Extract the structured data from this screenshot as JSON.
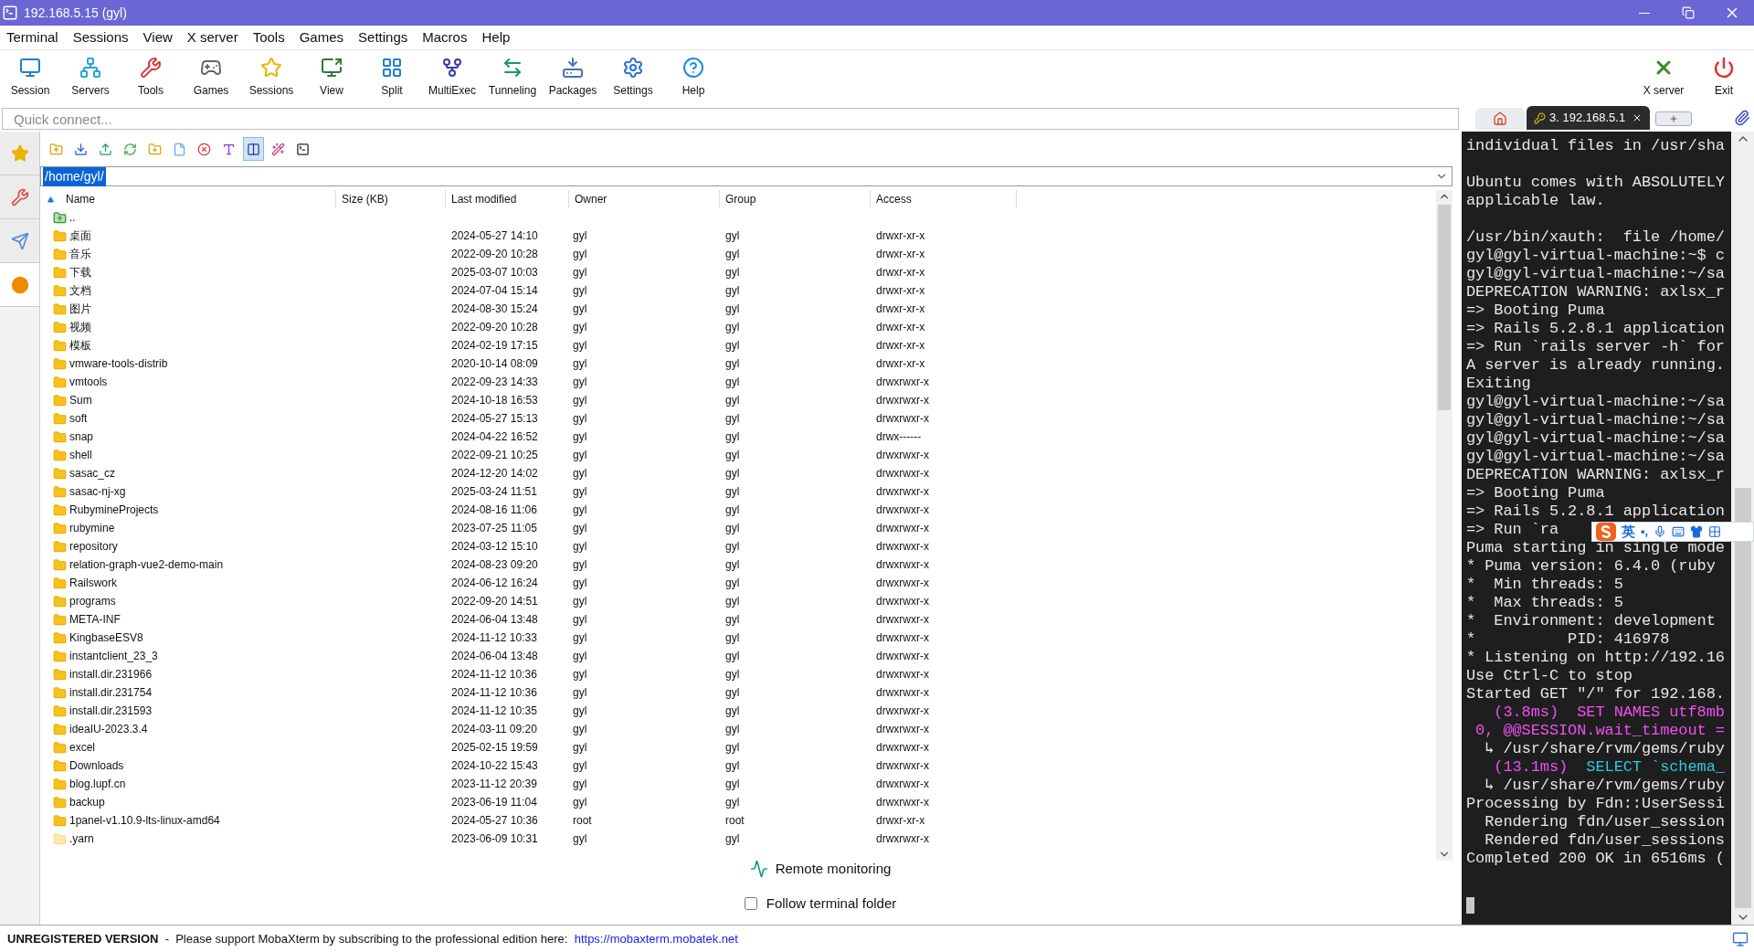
{
  "window": {
    "title": "192.168.5.15 (gyl)"
  },
  "menu": [
    "Terminal",
    "Sessions",
    "View",
    "X server",
    "Tools",
    "Games",
    "Settings",
    "Macros",
    "Help"
  ],
  "toolbar": [
    "Session",
    "Servers",
    "Tools",
    "Games",
    "Sessions",
    "View",
    "Split",
    "MultiExec",
    "Tunneling",
    "Packages",
    "Settings",
    "Help"
  ],
  "toolbar_right": [
    "X server",
    "Exit"
  ],
  "quick_connect": {
    "placeholder": "Quick connect..."
  },
  "session_tabs": [
    {
      "kind": "home",
      "selected": false
    },
    {
      "kind": "terminal",
      "label": "3. 192.168.5.1",
      "selected": true
    },
    {
      "kind": "new",
      "selected": false
    }
  ],
  "sidebar_tabs": [
    {
      "selected": false
    },
    {
      "selected": false
    },
    {
      "selected": false
    },
    {
      "selected": true
    }
  ],
  "file_tools": [
    {
      "pressed": false
    },
    {
      "pressed": false
    },
    {
      "pressed": false
    },
    {
      "pressed": false
    },
    {
      "pressed": false
    },
    {
      "pressed": false
    },
    {
      "pressed": false
    },
    {
      "pressed": false
    },
    {
      "pressed": true
    },
    {
      "pressed": false
    },
    {
      "pressed": false
    }
  ],
  "path": "/home/gyl/",
  "columns": [
    {
      "label": "Name",
      "sorted": true
    },
    {
      "label": "Size (KB)",
      "sorted": false
    },
    {
      "label": "Last modified",
      "sorted": false
    },
    {
      "label": "Owner",
      "sorted": false
    },
    {
      "label": "Group",
      "sorted": false
    },
    {
      "label": "Access",
      "sorted": false
    }
  ],
  "rows": [
    {
      "kind": "parent",
      "name": ".."
    },
    {
      "kind": "folder",
      "name": "桌面",
      "modified": "2024-05-27 14:10",
      "owner": "gyl",
      "group": "gyl",
      "access": "drwxr-xr-x"
    },
    {
      "kind": "folder",
      "name": "音乐",
      "modified": "2022-09-20 10:28",
      "owner": "gyl",
      "group": "gyl",
      "access": "drwxr-xr-x"
    },
    {
      "kind": "folder",
      "name": "下载",
      "modified": "2025-03-07 10:03",
      "owner": "gyl",
      "group": "gyl",
      "access": "drwxr-xr-x"
    },
    {
      "kind": "folder",
      "name": "文档",
      "modified": "2024-07-04 15:14",
      "owner": "gyl",
      "group": "gyl",
      "access": "drwxr-xr-x"
    },
    {
      "kind": "folder",
      "name": "图片",
      "modified": "2024-08-30 15:24",
      "owner": "gyl",
      "group": "gyl",
      "access": "drwxr-xr-x"
    },
    {
      "kind": "folder",
      "name": "视频",
      "modified": "2022-09-20 10:28",
      "owner": "gyl",
      "group": "gyl",
      "access": "drwxr-xr-x"
    },
    {
      "kind": "folder",
      "name": "模板",
      "modified": "2024-02-19 17:15",
      "owner": "gyl",
      "group": "gyl",
      "access": "drwxr-xr-x"
    },
    {
      "kind": "folder",
      "name": "vmware-tools-distrib",
      "modified": "2020-10-14 08:09",
      "owner": "gyl",
      "group": "gyl",
      "access": "drwxr-xr-x"
    },
    {
      "kind": "folder",
      "name": "vmtools",
      "modified": "2022-09-23 14:33",
      "owner": "gyl",
      "group": "gyl",
      "access": "drwxrwxr-x"
    },
    {
      "kind": "folder",
      "name": "Sum",
      "modified": "2024-10-18 16:53",
      "owner": "gyl",
      "group": "gyl",
      "access": "drwxrwxr-x"
    },
    {
      "kind": "folder",
      "name": "soft",
      "modified": "2024-05-27 15:13",
      "owner": "gyl",
      "group": "gyl",
      "access": "drwxrwxr-x"
    },
    {
      "kind": "folder",
      "name": "snap",
      "modified": "2024-04-22 16:52",
      "owner": "gyl",
      "group": "gyl",
      "access": "drwx------"
    },
    {
      "kind": "folder",
      "name": "shell",
      "modified": "2022-09-21 10:25",
      "owner": "gyl",
      "group": "gyl",
      "access": "drwxrwxr-x"
    },
    {
      "kind": "folder",
      "name": "sasac_cz",
      "modified": "2024-12-20 14:02",
      "owner": "gyl",
      "group": "gyl",
      "access": "drwxrwxr-x"
    },
    {
      "kind": "folder",
      "name": "sasac-nj-xg",
      "modified": "2025-03-24 11:51",
      "owner": "gyl",
      "group": "gyl",
      "access": "drwxrwxr-x"
    },
    {
      "kind": "folder",
      "name": "RubymineProjects",
      "modified": "2024-08-16 11:06",
      "owner": "gyl",
      "group": "gyl",
      "access": "drwxrwxr-x"
    },
    {
      "kind": "folder",
      "name": "rubymine",
      "modified": "2023-07-25 11:05",
      "owner": "gyl",
      "group": "gyl",
      "access": "drwxrwxr-x"
    },
    {
      "kind": "folder",
      "name": "repository",
      "modified": "2024-03-12 15:10",
      "owner": "gyl",
      "group": "gyl",
      "access": "drwxrwxr-x"
    },
    {
      "kind": "folder",
      "name": "relation-graph-vue2-demo-main",
      "modified": "2024-08-23 09:20",
      "owner": "gyl",
      "group": "gyl",
      "access": "drwxrwxr-x"
    },
    {
      "kind": "folder",
      "name": "Railswork",
      "modified": "2024-06-12 16:24",
      "owner": "gyl",
      "group": "gyl",
      "access": "drwxrwxr-x"
    },
    {
      "kind": "folder",
      "name": "programs",
      "modified": "2022-09-20 14:51",
      "owner": "gyl",
      "group": "gyl",
      "access": "drwxrwxr-x"
    },
    {
      "kind": "folder",
      "name": "META-INF",
      "modified": "2024-06-04 13:48",
      "owner": "gyl",
      "group": "gyl",
      "access": "drwxrwxr-x"
    },
    {
      "kind": "folder",
      "name": "KingbaseESV8",
      "modified": "2024-11-12 10:33",
      "owner": "gyl",
      "group": "gyl",
      "access": "drwxrwxr-x"
    },
    {
      "kind": "folder",
      "name": "instantclient_23_3",
      "modified": "2024-06-04 13:48",
      "owner": "gyl",
      "group": "gyl",
      "access": "drwxrwxr-x"
    },
    {
      "kind": "folder",
      "name": "install.dir.231966",
      "modified": "2024-11-12 10:36",
      "owner": "gyl",
      "group": "gyl",
      "access": "drwxrwxr-x"
    },
    {
      "kind": "folder",
      "name": "install.dir.231754",
      "modified": "2024-11-12 10:36",
      "owner": "gyl",
      "group": "gyl",
      "access": "drwxrwxr-x"
    },
    {
      "kind": "folder",
      "name": "install.dir.231593",
      "modified": "2024-11-12 10:35",
      "owner": "gyl",
      "group": "gyl",
      "access": "drwxrwxr-x"
    },
    {
      "kind": "folder",
      "name": "ideaIU-2023.3.4",
      "modified": "2024-03-11 09:20",
      "owner": "gyl",
      "group": "gyl",
      "access": "drwxrwxr-x"
    },
    {
      "kind": "folder",
      "name": "excel",
      "modified": "2025-02-15 19:59",
      "owner": "gyl",
      "group": "gyl",
      "access": "drwxrwxr-x"
    },
    {
      "kind": "folder",
      "name": "Downloads",
      "modified": "2024-10-22 15:43",
      "owner": "gyl",
      "group": "gyl",
      "access": "drwxrwxr-x"
    },
    {
      "kind": "folder",
      "name": "blog.lupf.cn",
      "modified": "2023-11-12 20:39",
      "owner": "gyl",
      "group": "gyl",
      "access": "drwxrwxr-x"
    },
    {
      "kind": "folder",
      "name": "backup",
      "modified": "2023-06-19 11:04",
      "owner": "gyl",
      "group": "gyl",
      "access": "drwxrwxr-x"
    },
    {
      "kind": "folder",
      "name": "1panel-v1.10.9-lts-linux-amd64",
      "modified": "2024-05-27 10:36",
      "owner": "root",
      "group": "root",
      "access": "drwxr-xr-x"
    },
    {
      "kind": "hidden",
      "name": ".yarn",
      "modified": "2023-06-09 10:31",
      "owner": "gyl",
      "group": "gyl",
      "access": "drwxrwxr-x"
    }
  ],
  "remote_monitoring": "Remote monitoring",
  "follow_folder": {
    "label": "Follow terminal folder",
    "checked": false
  },
  "terminal": [
    {
      "lines": [
        {
          "text": "individual files in /usr/sha"
        }
      ]
    },
    {
      "lines": [
        {
          "text": "Ubuntu comes with ABSOLUTELY"
        },
        {
          "text": "applicable law."
        }
      ]
    },
    {
      "lines": [
        {
          "text": "/usr/bin/xauth:  file /home/"
        },
        {
          "text": "gyl@gyl-virtual-machine:~$ c"
        },
        {
          "text": "gyl@gyl-virtual-machine:~/sa"
        },
        {
          "text": "DEPRECATION WARNING: axlsx_r"
        },
        {
          "text": "=> Booting Puma"
        },
        {
          "text": "=> Rails 5.2.8.1 application"
        },
        {
          "text": "=> Run `rails server -h` for"
        },
        {
          "text": "A server is already running."
        },
        {
          "text": "Exiting"
        },
        {
          "text": "gyl@gyl-virtual-machine:~/sa"
        },
        {
          "text": "gyl@gyl-virtual-machine:~/sa"
        },
        {
          "text": "gyl@gyl-virtual-machine:~/sa"
        },
        {
          "text": "gyl@gyl-virtual-machine:~/sa"
        },
        {
          "text": "DEPRECATION WARNING: axlsx_r"
        },
        {
          "text": "=> Booting Puma"
        },
        {
          "text": "=> Rails 5.2.8.1 application"
        },
        {
          "text": "=> Run `ra"
        },
        {
          "text": "Puma starting in single mode"
        },
        {
          "text": "* Puma version: 6.4.0 (ruby"
        },
        {
          "text": "*  Min threads: 5"
        },
        {
          "text": "*  Max threads: 5"
        },
        {
          "text": "*  Environment: development"
        },
        {
          "text": "*          PID: 416978"
        },
        {
          "text": "* Listening on http://192.16"
        },
        {
          "text": "Use Ctrl-C to stop"
        },
        {
          "text": "Started GET \"/\" for 192.168."
        },
        {
          "segments": [
            {
              "text": "   (3.8ms)  SET NAMES utf8mb",
              "color": "#f050f0"
            }
          ]
        },
        {
          "segments": [
            {
              "text": " 0, @@SESSION.wait_timeout =",
              "color": "#f050f0"
            }
          ]
        },
        {
          "text": "  ↳ /usr/share/rvm/gems/ruby"
        },
        {
          "segments": [
            {
              "text": "   (13.1ms)  ",
              "color": "#f050f0"
            },
            {
              "text": "SELECT `schema_",
              "color": "#30c8e0"
            }
          ]
        },
        {
          "text": "  ↳ /usr/share/rvm/gems/ruby"
        },
        {
          "text": "Processing by Fdn::UserSessi"
        },
        {
          "text": "  Rendering fdn/user_session"
        },
        {
          "text": "  Rendered fdn/user_sessions"
        },
        {
          "text": "Completed 200 OK in 6516ms ("
        }
      ]
    }
  ],
  "ime": {
    "mode": "英",
    "punctuation": "•,"
  },
  "status": {
    "message": "**UNREGISTERED VERSION**  -  Please support MobaXterm by subscribing to the professional edition here:",
    "link": "https://mobaxterm.mobatek.net"
  }
}
